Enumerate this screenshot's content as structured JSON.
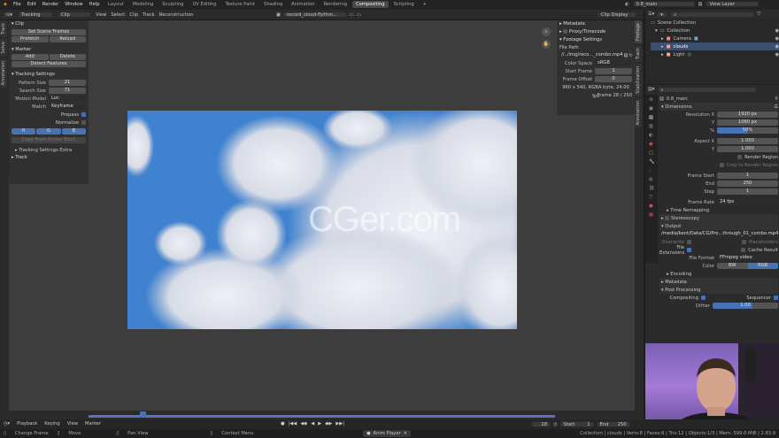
{
  "menu": [
    "File",
    "Edit",
    "Render",
    "Window",
    "Help"
  ],
  "workspaces": [
    "Layout",
    "Modeling",
    "Sculpting",
    "UV Editing",
    "Texture Paint",
    "Shading",
    "Animation",
    "Rendering",
    "Compositing",
    "Scripting"
  ],
  "active_workspace": "Compositing",
  "scene": {
    "name": "0.8_main",
    "view_layer": "View Layer"
  },
  "editor_header": {
    "mode": "Tracking",
    "clip_label": "Clip",
    "menus": [
      "View",
      "Select",
      "Clip",
      "Track",
      "Reconstruction"
    ],
    "clip_name": "record_cloud-flythro...",
    "display": "Clip Display"
  },
  "left_tabs": [
    "Track",
    "Solve",
    "Annotation"
  ],
  "clip_panel": {
    "title": "Clip",
    "set_scene_frames": "Set Scene Frames",
    "prefetch": "Prefetch",
    "reload": "Reload"
  },
  "marker_panel": {
    "title": "Marker",
    "add": "Add",
    "delete": "Delete",
    "detect": "Detect Features"
  },
  "tracking_settings": {
    "title": "Tracking Settings",
    "pattern_size_label": "Pattern Size",
    "pattern_size": "21",
    "search_size_label": "Search Size",
    "search_size": "71",
    "motion_model_label": "Motion Model",
    "motion_model": "Loc",
    "match_label": "Match",
    "match": "Keyframe",
    "prepass": "Prepass",
    "normalize": "Normalize",
    "channels": [
      "R",
      "G",
      "B"
    ],
    "copy_active": "Copy From Active Track",
    "extra": "Tracking Settings Extra"
  },
  "track_panel": {
    "title": "Track"
  },
  "right_panel": {
    "metadata": "Metadata",
    "proxy": "Proxy/Timecode",
    "footage_settings": "Footage Settings",
    "file_path_label": "File Path",
    "file_path": "//../img/reco..._combo.mp4",
    "color_space_label": "Color Space",
    "color_space": "sRGB",
    "start_frame_label": "Start Frame",
    "start_frame": "1",
    "frame_offset_label": "Frame Offset",
    "frame_offset": "0",
    "info": "960 x 540, RGBA byte, 24.00 fps",
    "frame_info": "Frame 28 / 250"
  },
  "right_tabs": [
    "Footage",
    "Track",
    "Stabilization",
    "Annotation"
  ],
  "watermark": "CGer.com",
  "outliner": {
    "root": "Scene Collection",
    "collection": "Collection",
    "items": [
      "Camera",
      "clouds",
      "Light"
    ]
  },
  "props": {
    "scene_name": "0.8_main",
    "dimensions": "Dimensions",
    "res_x_label": "Resolution X",
    "res_x": "1920 px",
    "res_y_label": "Y",
    "res_y": "1080 px",
    "pct_label": "%",
    "pct": "50%",
    "aspect_x_label": "Aspect X",
    "aspect_x": "1.000",
    "aspect_y_label": "Y",
    "aspect_y": "1.000",
    "render_region": "Render Region",
    "crop_region": "Crop to Render Region",
    "frame_start_label": "Frame Start",
    "frame_start": "1",
    "end_label": "End",
    "end": "250",
    "step_label": "Step",
    "step": "1",
    "frame_rate_label": "Frame Rate",
    "frame_rate": "24 fps",
    "time_remapping": "Time Remapping",
    "stereoscopy": "Stereoscopy",
    "output": "Output",
    "output_path": "/media/kent/Data/CG/Pro...through_01_combo.mp4",
    "overwrite": "Overwrite",
    "placeholders": "Placeholders",
    "file_ext": "File Extensions",
    "cache_result": "Cache Result",
    "file_format_label": "File Format",
    "file_format": "FFmpeg video",
    "color_label": "Color",
    "color_bw": "BW",
    "color_rgb": "RGB",
    "encoding": "Encoding",
    "metadata": "Metadata",
    "post_processing": "Post Processing",
    "compositing": "Compositing",
    "sequencer": "Sequencer",
    "dither_label": "Dither",
    "dither": "1.00"
  },
  "timeline": {
    "current": "28",
    "start_label": "Start",
    "start": "1",
    "end_label": "End",
    "end": "250",
    "menus": [
      "Playback",
      "Keying",
      "View",
      "Marker"
    ]
  },
  "status": {
    "change_frame": "Change Frame",
    "move": "Move",
    "pan_view": "Pan View",
    "context": "Context Menu",
    "anim_player": "Anim Player",
    "stats": "Collection | clouds | Verts:8 | Faces:6 | Tris:12 | Objects:1/3 | Mem: 599.0 MiB | 2.83.9"
  },
  "colors": {
    "accent": "#4772b3",
    "timeline": "#5d6fc0",
    "sky": "#4a86cc"
  }
}
